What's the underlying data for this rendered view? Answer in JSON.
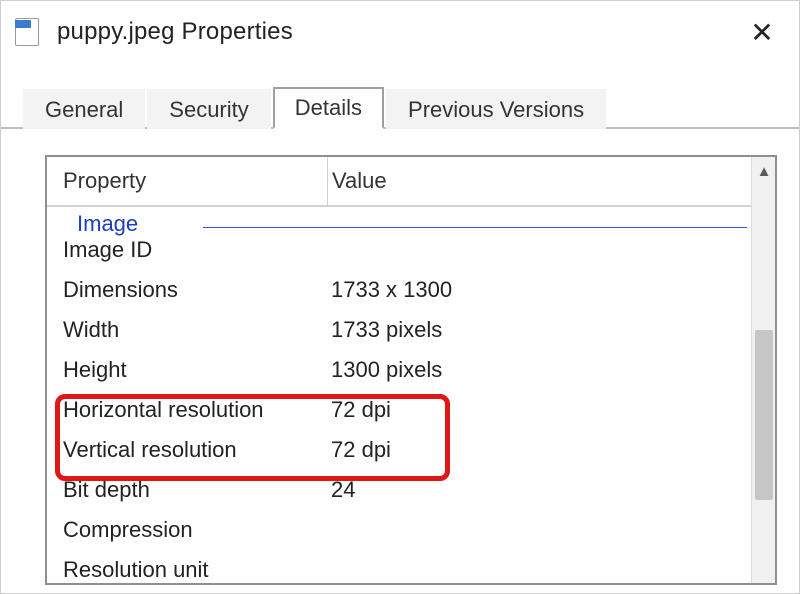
{
  "titlebar": {
    "title": "puppy.jpeg Properties",
    "close_glyph": "✕"
  },
  "tabs": {
    "general": "General",
    "security": "Security",
    "details": "Details",
    "previous": "Previous Versions",
    "active_index": 2
  },
  "headers": {
    "property": "Property",
    "value": "Value"
  },
  "section": {
    "image_label": "Image"
  },
  "rows": [
    {
      "property": "Image ID",
      "value": ""
    },
    {
      "property": "Dimensions",
      "value": "1733 x 1300"
    },
    {
      "property": "Width",
      "value": "1733 pixels"
    },
    {
      "property": "Height",
      "value": "1300 pixels"
    },
    {
      "property": "Horizontal resolution",
      "value": "72 dpi"
    },
    {
      "property": "Vertical resolution",
      "value": "72 dpi"
    },
    {
      "property": "Bit depth",
      "value": "24"
    },
    {
      "property": "Compression",
      "value": ""
    },
    {
      "property": "Resolution unit",
      "value": ""
    }
  ],
  "scroll": {
    "up_glyph": "▲"
  }
}
